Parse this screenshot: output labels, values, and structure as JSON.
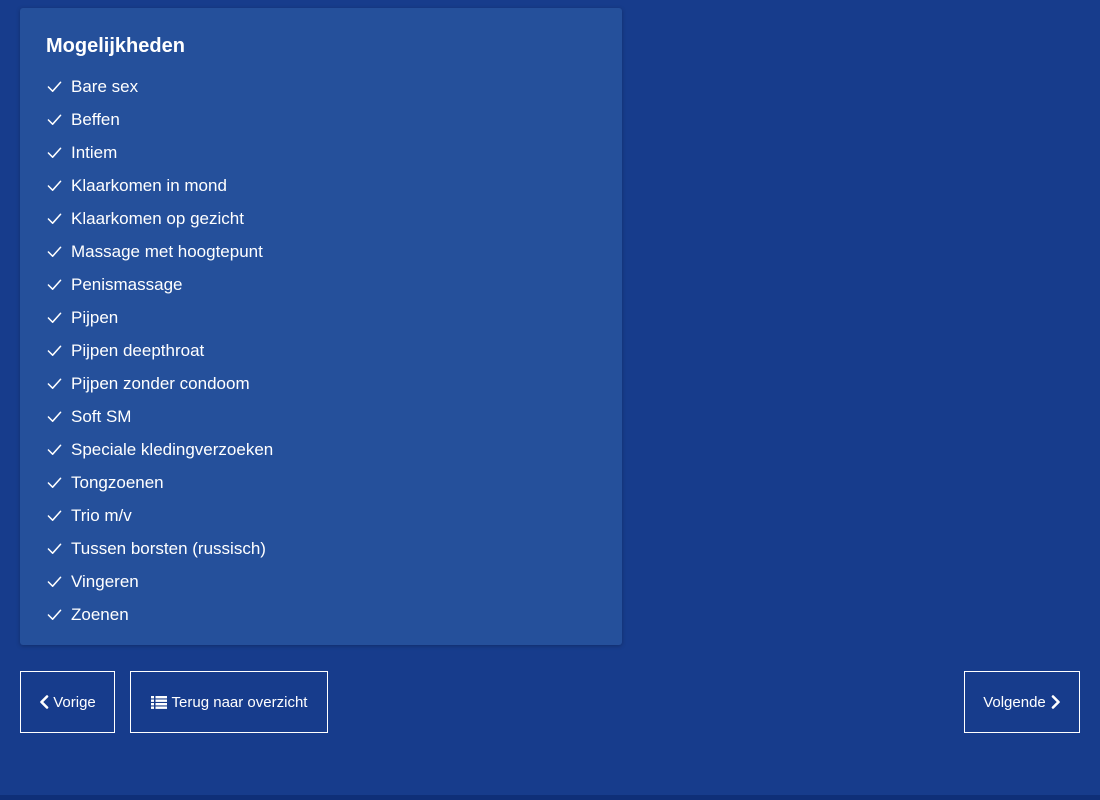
{
  "card": {
    "title": "Mogelijkheden",
    "item_icon": "check-icon",
    "items": [
      "Bare sex",
      "Beffen",
      "Intiem",
      "Klaarkomen in mond",
      "Klaarkomen op gezicht",
      "Massage met hoogtepunt",
      "Penismassage",
      "Pijpen",
      "Pijpen deepthroat",
      "Pijpen zonder condoom",
      "Soft SM",
      "Speciale kledingverzoeken",
      "Tongzoenen",
      "Trio m/v",
      "Tussen borsten (russisch)",
      "Vingeren",
      "Zoenen"
    ]
  },
  "navigation": {
    "prev_label": "Vorige",
    "prev_icon": "chevron-left-icon",
    "overview_label": "Terug naar overzicht",
    "overview_icon": "list-icon",
    "next_label": "Volgende",
    "next_icon": "chevron-right-icon"
  },
  "colors": {
    "page_background": "#173c8c",
    "card_background": "#25509b",
    "text": "#ffffff"
  }
}
